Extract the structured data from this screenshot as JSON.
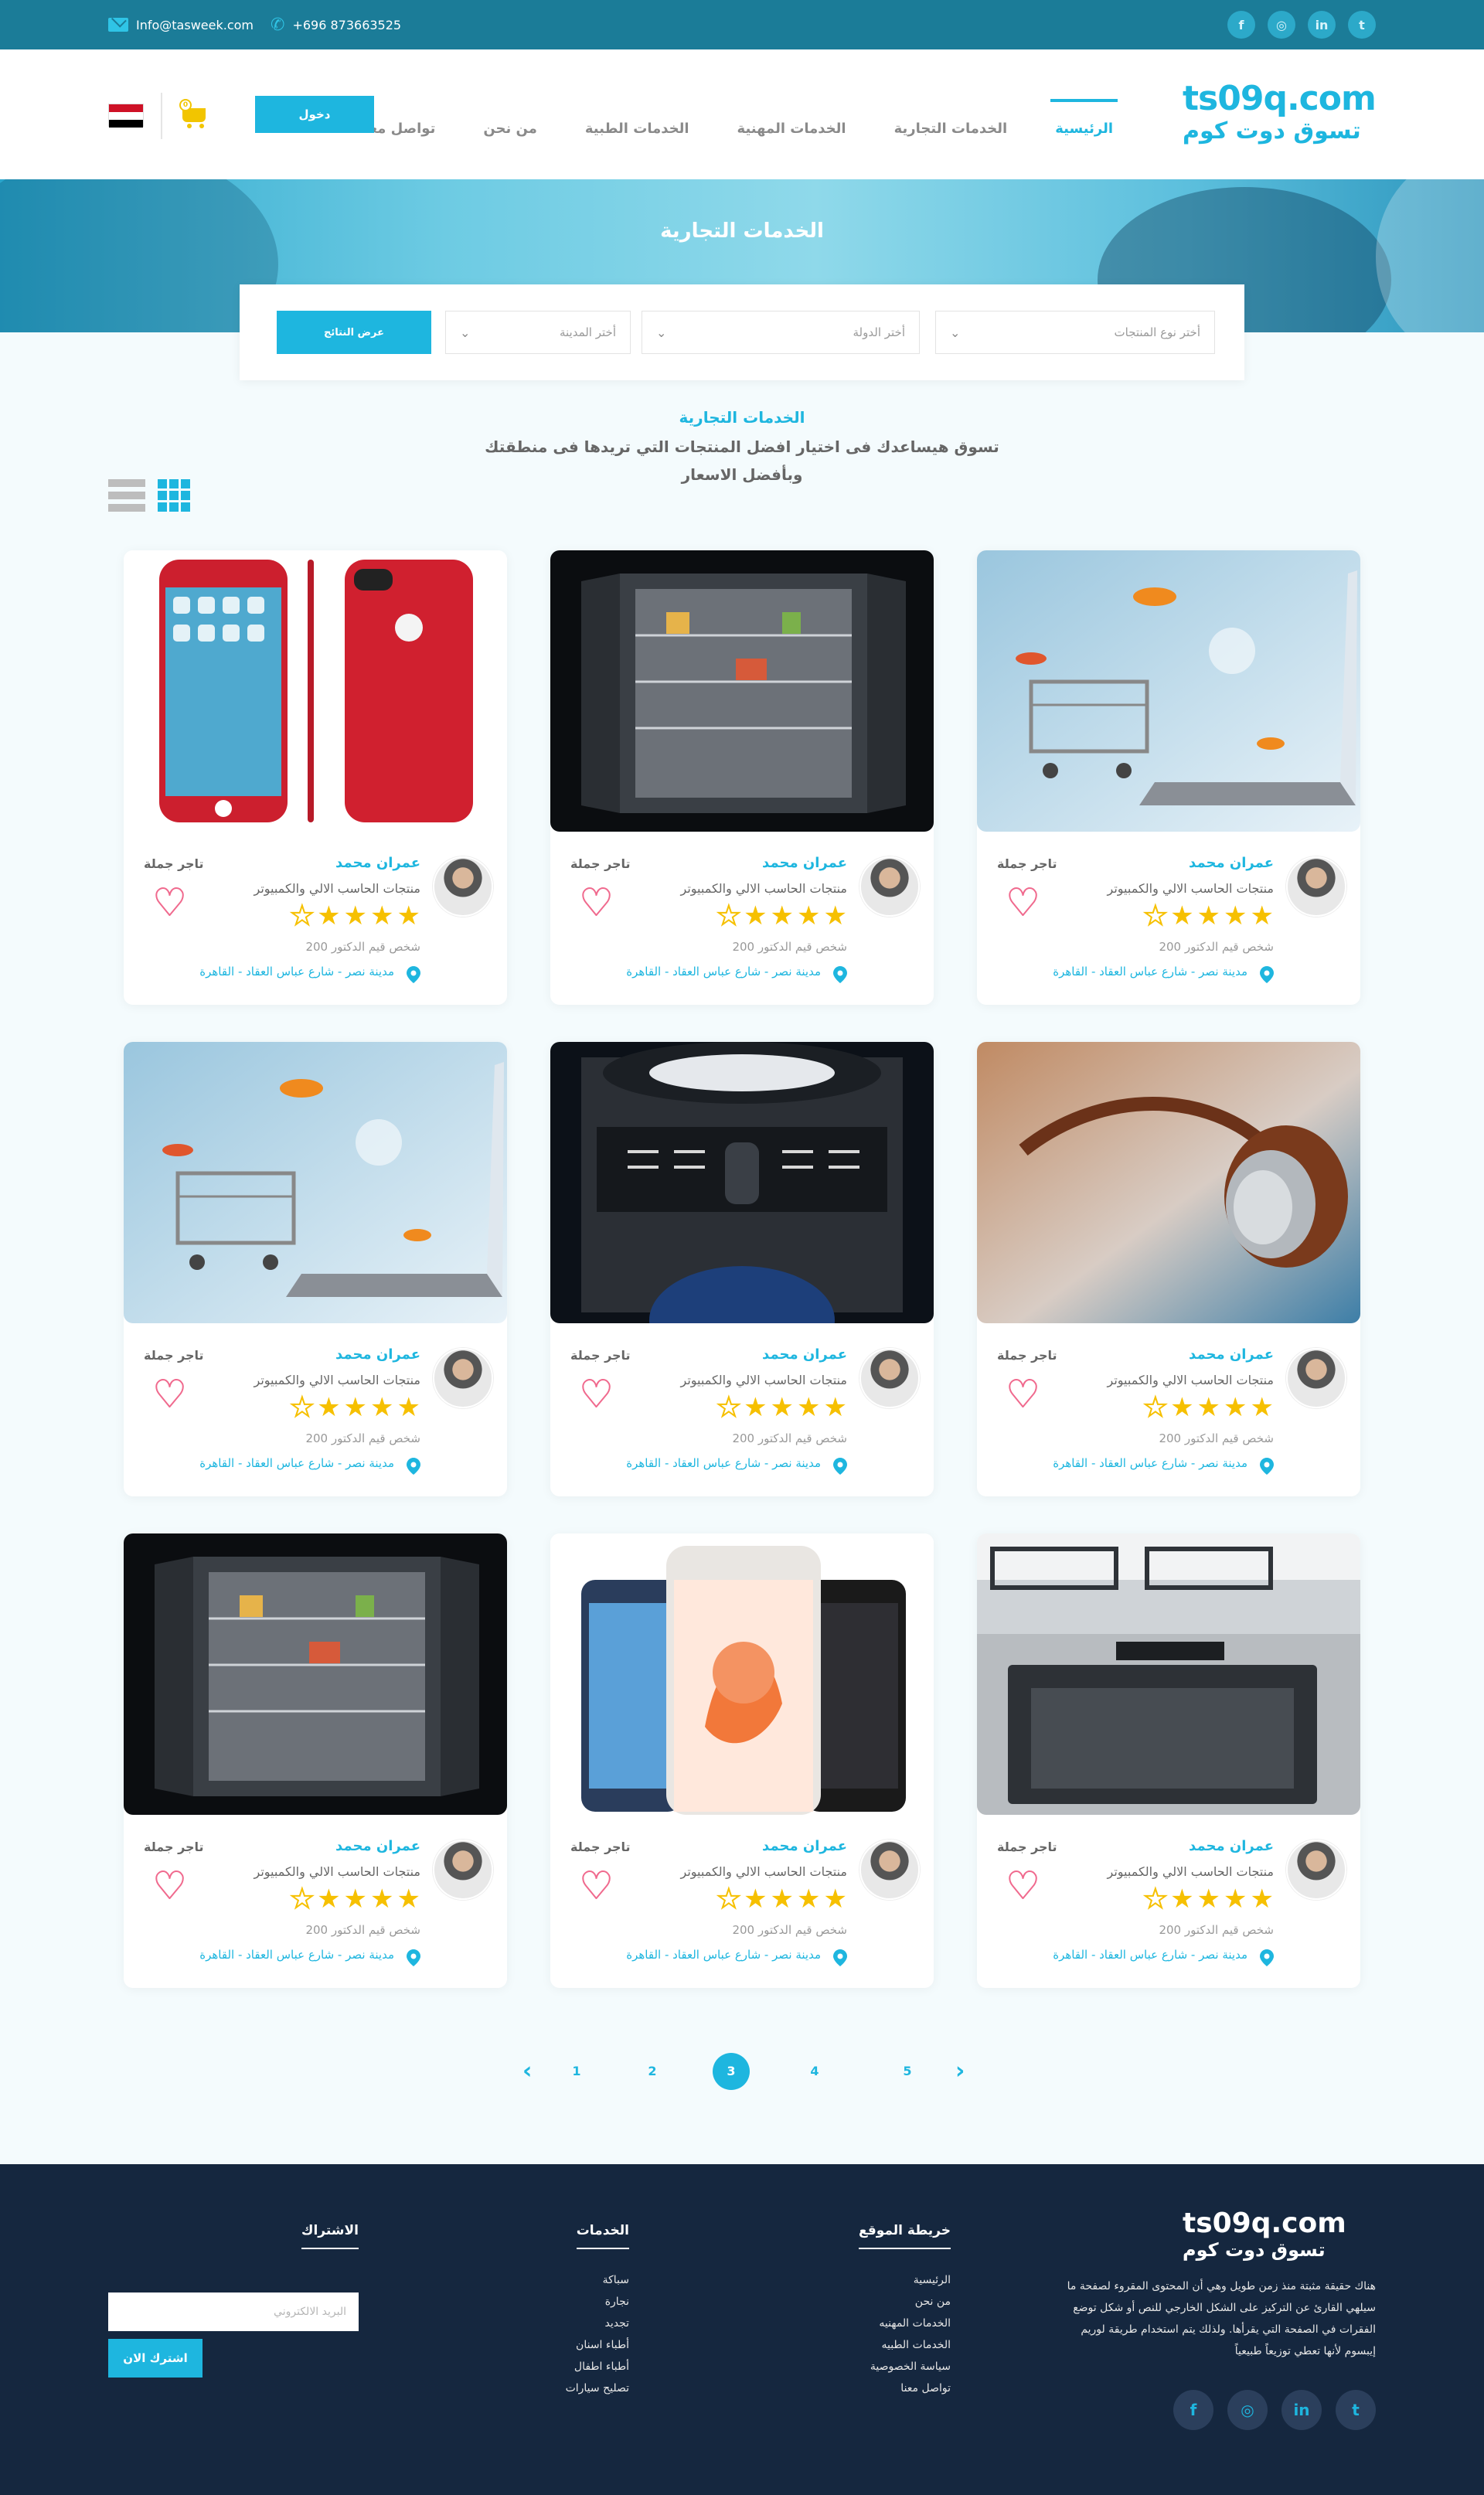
{
  "topbar": {
    "email": "Info@tasweek.com",
    "phone": "+696 873663525",
    "social_icons": [
      "twitter-icon",
      "linkedin-icon",
      "instagram-icon",
      "facebook-icon"
    ]
  },
  "header": {
    "logo_latin": "ts09q.com",
    "logo_arabic": "تسوق دوت كوم",
    "nav": [
      "الرئيسية",
      "الخدمات التجارية",
      "الخدمات المهنية",
      "الخدمات الطبية",
      "من نحن",
      "تواصل معنا"
    ],
    "nav_active_index": 0,
    "login_label": "دخول",
    "cart_count": "0"
  },
  "banner": {
    "title": "الخدمات التجارية"
  },
  "filter": {
    "product_type": "أختر نوع المنتجات",
    "country": "أختر الدولة",
    "city": "أختر المدينة",
    "search_label": "عرض النتائج"
  },
  "intro": {
    "title": "الخدمات التجارية",
    "text": "تسوق هيساعدك فى اختيار افضل المنتجات التي تريدها فى منطقتك وبأفضل الاسعار"
  },
  "product_images": [
    "laptop-cart-goldfish",
    "open-refrigerator",
    "red-iphone",
    "headphones",
    "washing-machine",
    "laptop-cart-goldfish",
    "gas-stove-oven",
    "smartphones",
    "open-refrigerator"
  ],
  "card_template": {
    "name": "عمران محمد",
    "category": "منتجات الحاسب الالي والكمبيوتر",
    "role": "تاجر جملة",
    "rating": 4,
    "rating_max": 5,
    "visitors": "200 شخص قيم الدكتور",
    "location": "مدينة نصر - شارع عباس العقاد - القاهرة"
  },
  "pagination": {
    "pages": [
      "5",
      "4",
      "3",
      "2",
      "1"
    ],
    "active": "3"
  },
  "footer": {
    "logo_latin": "ts09q.com",
    "logo_arabic": "تسوق دوت كوم",
    "about": "هناك حقيقة مثبتة منذ زمن طويل وهي أن المحتوى المقروء لصفحة ما سيلهي القارئ عن التركيز على الشكل الخارجي للنص أو شكل توضع الفقرات في الصفحة التي يقرأها. ولذلك يتم استخدام طريقة لوريم إيبسوم لأنها تعطي توزيعاً طبيعياً",
    "sitemap_title": "خريطة الموقع",
    "sitemap": [
      "الرئيسية",
      "من نحن",
      "الخدمات المهنيه",
      "الخدمات الطبيه",
      "سياسة الخصوصية",
      "تواصل معنا"
    ],
    "services_title": "الخدمات",
    "services": [
      "سباكة",
      "نجارة",
      "تجديد",
      "أطباء اسنان",
      "أطباء اطفال",
      "تصليح سيارات"
    ],
    "subscribe_title": "الاشتراك",
    "email_placeholder": "البريد الالكتروني",
    "subscribe_label": "اشترك الان"
  },
  "colors": {
    "brand": "#1eb6df",
    "topbar": "#1b7c98",
    "footer": "#15273f",
    "star": "#f6c000",
    "heart": "#f06a8e"
  }
}
